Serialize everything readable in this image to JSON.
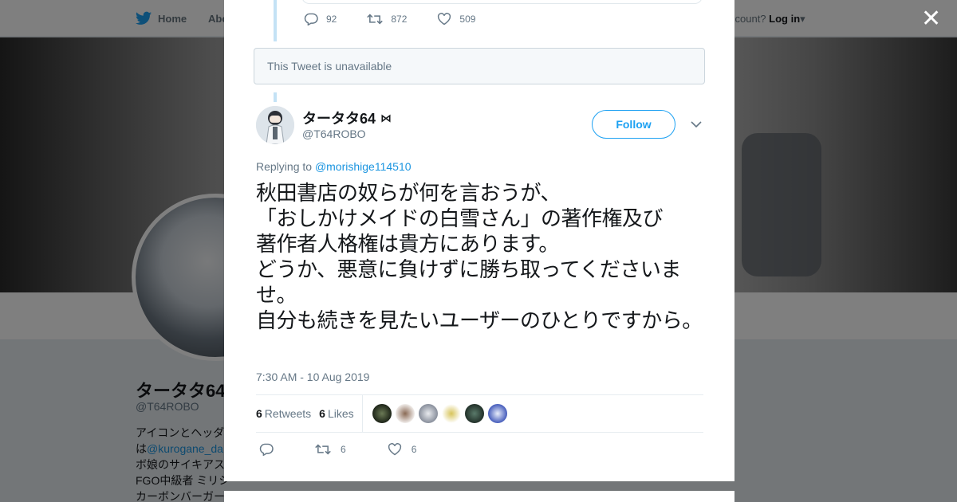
{
  "nav": {
    "home_label": "Home",
    "about_label": "Abo",
    "account_prompt": "ccount?",
    "login_label": "Log in"
  },
  "background_profile": {
    "name": "タータタ64",
    "handle": "@T64ROBO",
    "bio": {
      "line1": "アイコンとヘッダ",
      "line2_prefix": "は",
      "line2_link": "@kurogane_da",
      "line3": "ボ娘のサイキアス",
      "line4": "FGO中級者 ミリシ",
      "line5": "カーボンバーガー"
    }
  },
  "previous_tweet": {
    "replies": "92",
    "retweets": "872",
    "likes": "509"
  },
  "unavailable_text": "This Tweet is unavailable",
  "tweet": {
    "author_name": "タータタ64",
    "author_badge": "⋈",
    "author_handle": "@T64ROBO",
    "follow_label": "Follow",
    "replying_prefix": "Replying to",
    "replying_to": "@morishige114510",
    "text": "秋田書店の奴らが何を言おうが、\n「おしかけメイドの白雪さん」の著作権及び\n著作者人格権は貴方にあります。\nどうか、悪意に負けずに勝ち取ってくださいませ。\n自分も続きを見たいユーザーのひとりですから。",
    "timestamp": "7:30 AM - 10 Aug 2019",
    "retweet_count": "6",
    "retweet_label": "Retweets",
    "like_count": "6",
    "like_label": "Likes",
    "actions": {
      "retweets": "6",
      "likes": "6"
    }
  },
  "colors": {
    "accent": "#1da1f2",
    "link": "#1b95e0",
    "text": "#14171a",
    "muted": "#657786"
  },
  "icons": [
    "twitter-bird-icon",
    "close-icon",
    "reply-icon",
    "retweet-icon",
    "heart-icon",
    "chevron-down-icon",
    "caret-down-icon"
  ]
}
